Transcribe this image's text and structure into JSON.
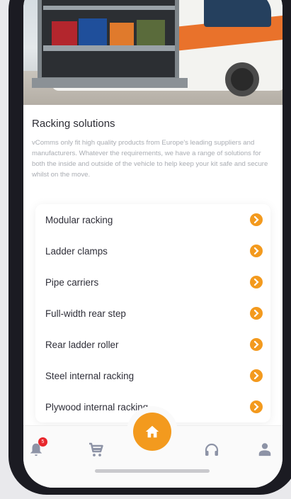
{
  "section": {
    "title": "Racking solutions",
    "description": "vComms only fit high quality products from Europe's leading suppliers and manufacturers. Whatever the requirements, we have a range of solutions for both the inside and outside of the vehicle to help keep your kit safe and secure whilst on the move."
  },
  "menu": {
    "items": [
      {
        "label": "Modular racking"
      },
      {
        "label": "Ladder clamps"
      },
      {
        "label": "Pipe carriers"
      },
      {
        "label": "Full-width rear step"
      },
      {
        "label": "Rear ladder roller"
      },
      {
        "label": "Steel internal racking"
      },
      {
        "label": "Plywood internal racking"
      }
    ]
  },
  "nav": {
    "notifications_badge": "5",
    "items": [
      {
        "icon": "bell-icon"
      },
      {
        "icon": "cart-icon"
      },
      {
        "icon": "home-icon"
      },
      {
        "icon": "headset-icon"
      },
      {
        "icon": "user-icon"
      }
    ]
  },
  "colors": {
    "accent": "#f39a1e",
    "badge": "#e8262c",
    "nav_icon": "#8d93a6"
  }
}
